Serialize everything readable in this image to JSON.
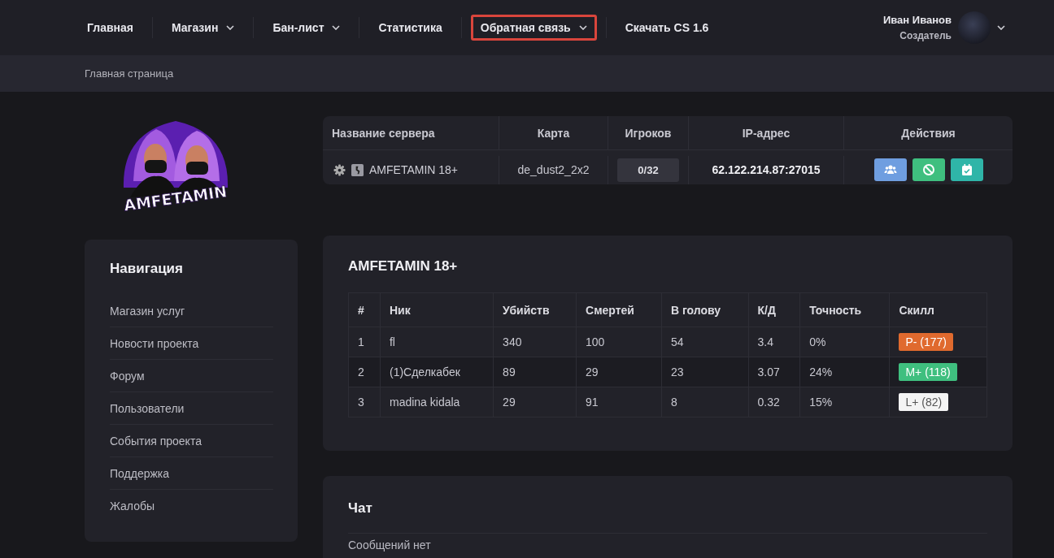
{
  "nav": {
    "items": [
      {
        "label": "Главная",
        "dropdown": false,
        "selected": false
      },
      {
        "label": "Магазин",
        "dropdown": true,
        "selected": false
      },
      {
        "label": "Бан-лист",
        "dropdown": true,
        "selected": false
      },
      {
        "label": "Статистика",
        "dropdown": false,
        "selected": false
      },
      {
        "label": "Обратная связь",
        "dropdown": true,
        "selected": true
      },
      {
        "label": "Скачать CS 1.6",
        "dropdown": false,
        "selected": false
      }
    ],
    "user": {
      "name": "Иван Иванов",
      "role": "Создатель"
    }
  },
  "breadcrumb": "Главная страница",
  "logo": {
    "text": "AMFETAMIN"
  },
  "server": {
    "columns": [
      "Название сервера",
      "Карта",
      "Игроков",
      "IP-адрес",
      "Действия"
    ],
    "name": "AMFETAMIN 18+",
    "map": "de_dust2_2x2",
    "players": "0/32",
    "ip": "62.122.214.87:27015",
    "actions": [
      {
        "kind": "players",
        "color": "#6f9ee0"
      },
      {
        "kind": "ban",
        "color": "#3fbf7f"
      },
      {
        "kind": "calendar",
        "color": "#2fb5a8"
      }
    ]
  },
  "sidebar": {
    "title": "Навигация",
    "items": [
      "Магазин услуг",
      "Новости проекта",
      "Форум",
      "Пользователи",
      "События проекта",
      "Поддержка",
      "Жалобы"
    ]
  },
  "stats": {
    "title": "AMFETAMIN 18+",
    "columns": [
      "#",
      "Ник",
      "Убийств",
      "Смертей",
      "В голову",
      "К/Д",
      "Точность",
      "Скилл"
    ],
    "rows": [
      {
        "cells": [
          "1",
          "fl",
          "340",
          "100",
          "54",
          "3.4",
          "0%"
        ],
        "skill": "P- (177)",
        "color": "#e06a2e"
      },
      {
        "cells": [
          "2",
          "(1)Сделкабек",
          "89",
          "29",
          "23",
          "3.07",
          "24%"
        ],
        "skill": "M+ (118)",
        "color": "#3fbf7f"
      },
      {
        "cells": [
          "3",
          "madina kidala",
          "29",
          "91",
          "8",
          "0.32",
          "15%"
        ],
        "skill": "L+ (82)",
        "color": "#f4f4f4"
      }
    ]
  },
  "chat": {
    "title": "Чат",
    "empty": "Сообщений нет"
  }
}
